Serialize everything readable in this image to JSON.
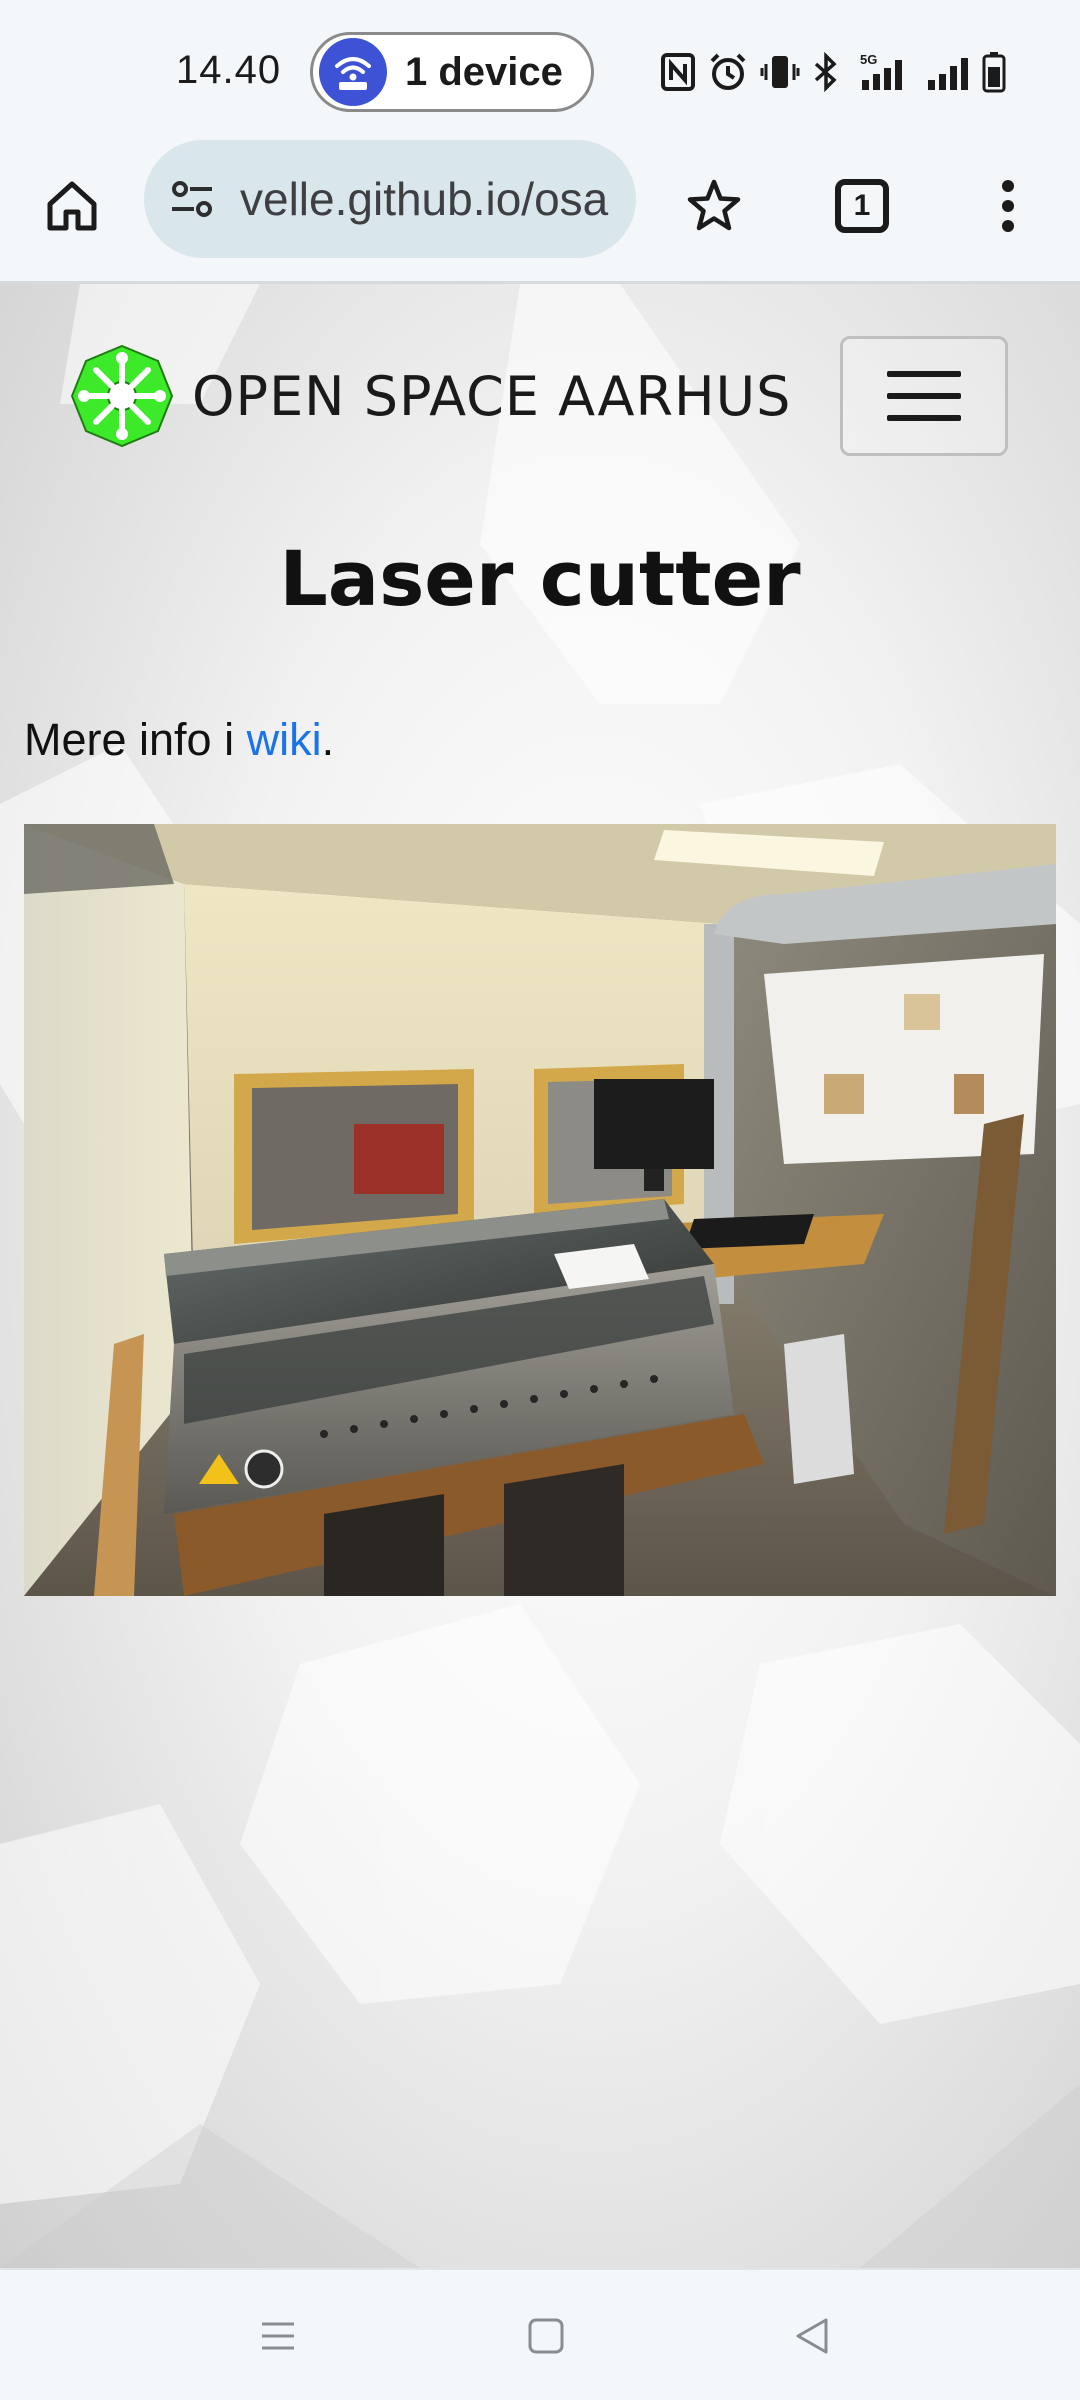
{
  "status_bar": {
    "time": "14.40",
    "hotspot_label": "1 device",
    "network": "5G"
  },
  "browser": {
    "url": "velle.github.io/osa",
    "tab_count": "1"
  },
  "site": {
    "brand": "OPEN SPACE AARHUS",
    "brand_color": "#3dea2a",
    "page_title": "Laser cutter",
    "intro_text": "Mere info i ",
    "intro_link": "wiki",
    "intro_end": "."
  },
  "colors": {
    "link": "#1a73e8",
    "url_bar": "#d9e6ec",
    "hotspot": "#3d52d5"
  },
  "icons": {
    "home": "home-icon",
    "site_info": "tune-icon",
    "star": "star-outline-icon",
    "menu": "more-vert-icon",
    "hamburger": "menu-icon"
  }
}
